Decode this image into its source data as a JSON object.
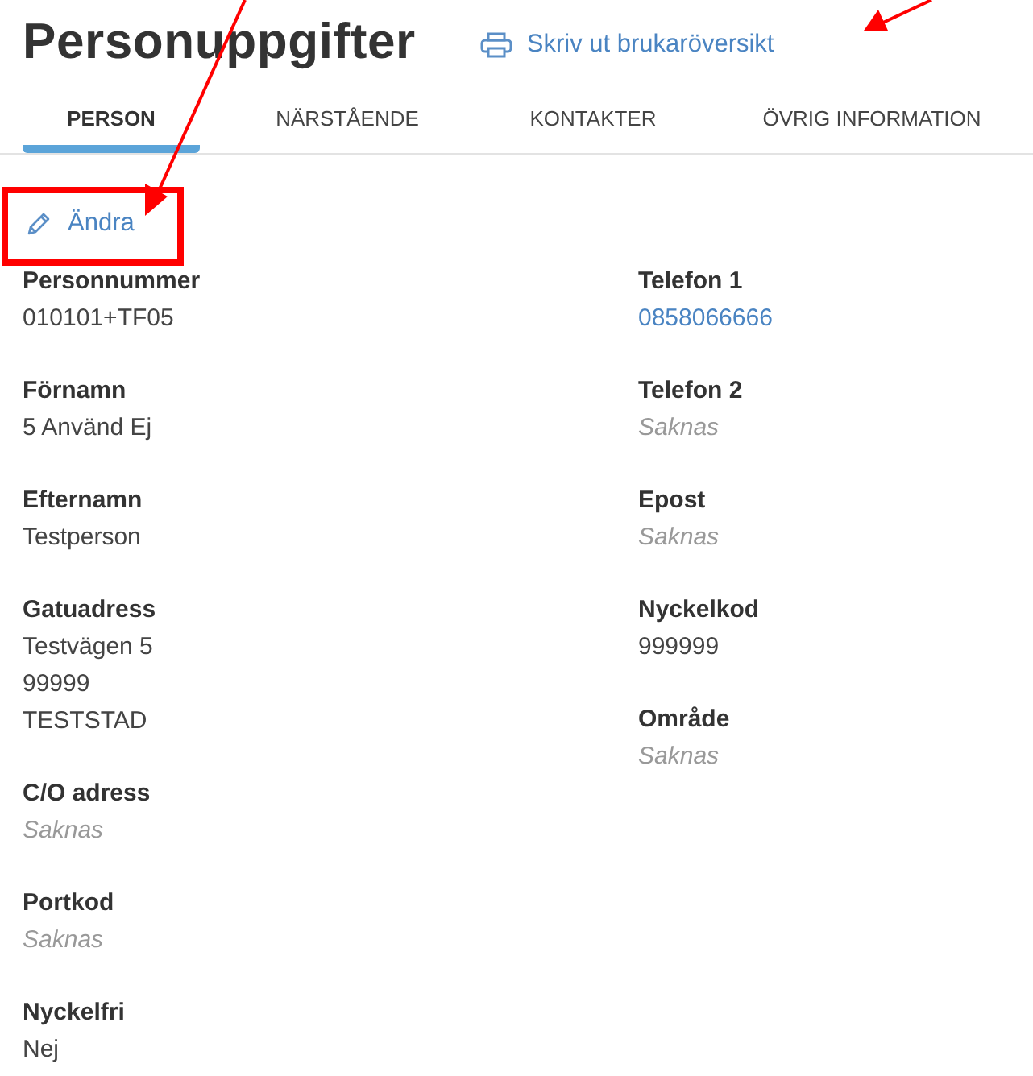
{
  "title": "Personuppgifter",
  "print_link": {
    "label": "Skriv ut brukaröversikt"
  },
  "tabs": [
    {
      "label": "PERSON",
      "selected": true
    },
    {
      "label": "NÄRSTÅENDE",
      "selected": false
    },
    {
      "label": "KONTAKTER",
      "selected": false
    },
    {
      "label": "ÖVRIG INFORMATION",
      "selected": false
    }
  ],
  "edit_link": {
    "label": "Ändra"
  },
  "columns": [
    {
      "fields": [
        {
          "label": "Personnummer",
          "kind": "text",
          "values": [
            "010101+TF05"
          ]
        },
        {
          "label": "Förnamn",
          "kind": "text",
          "values": [
            "5 Använd Ej"
          ]
        },
        {
          "label": "Efternamn",
          "kind": "text",
          "values": [
            "Testperson"
          ]
        },
        {
          "label": "Gatuadress",
          "kind": "text",
          "values": [
            "Testvägen 5",
            "99999",
            "TESTSTAD"
          ]
        },
        {
          "label": "C/O adress",
          "kind": "missing",
          "values": [
            "Saknas"
          ]
        },
        {
          "label": "Portkod",
          "kind": "missing",
          "values": [
            "Saknas"
          ]
        },
        {
          "label": "Nyckelfri",
          "kind": "text",
          "values": [
            "Nej"
          ]
        }
      ]
    },
    {
      "fields": [
        {
          "label": "Telefon 1",
          "kind": "link",
          "values": [
            "0858066666"
          ]
        },
        {
          "label": "Telefon 2",
          "kind": "missing",
          "values": [
            "Saknas"
          ]
        },
        {
          "label": "Epost",
          "kind": "missing",
          "values": [
            "Saknas"
          ]
        },
        {
          "label": "Nyckelkod",
          "kind": "text",
          "values": [
            "999999"
          ]
        },
        {
          "label": "Område",
          "kind": "missing",
          "values": [
            "Saknas"
          ]
        }
      ]
    }
  ]
}
